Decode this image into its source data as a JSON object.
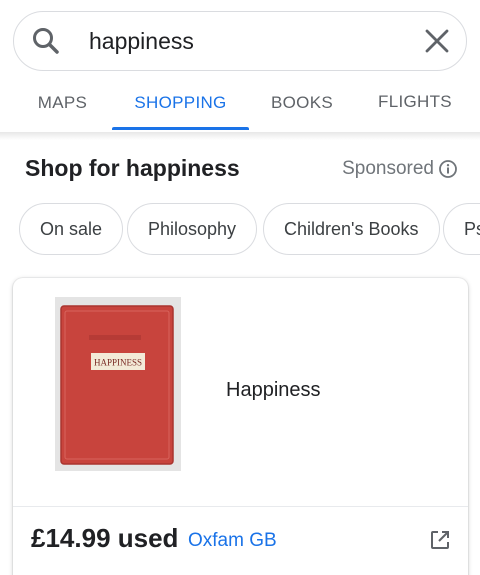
{
  "search": {
    "query": "happiness",
    "icon": "search-icon",
    "clear_icon": "close-icon"
  },
  "tabs": [
    {
      "label": "MAPS",
      "active": false
    },
    {
      "label": "SHOPPING",
      "active": true
    },
    {
      "label": "BOOKS",
      "active": false
    },
    {
      "label": "FLIGHTS",
      "active": false
    }
  ],
  "section": {
    "title": "Shop for happiness",
    "sponsored_label": "Sponsored",
    "info_icon": "info-icon"
  },
  "chips": [
    {
      "label": "On sale"
    },
    {
      "label": "Philosophy"
    },
    {
      "label": "Children's Books"
    },
    {
      "label": "Ps"
    }
  ],
  "product": {
    "title": "Happiness",
    "cover_text": "HAPPINESS",
    "price": "£14.99 used",
    "merchant": "Oxfam GB",
    "external_icon": "open-in-new-icon"
  },
  "colors": {
    "accent": "#1a73e8",
    "text": "#202124",
    "muted": "#5f6368",
    "border": "#dadce0",
    "book_red": "#c8443d"
  }
}
